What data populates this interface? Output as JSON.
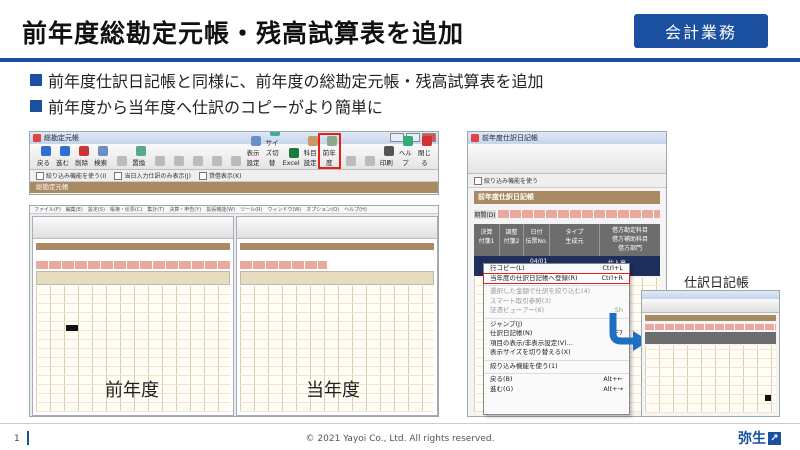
{
  "slide": {
    "title": "前年度総勘定元帳・残高試算表を追加",
    "badge": "会計業務",
    "bullets": [
      "前年度仕訳日記帳と同様に、前年度の総勘定元帳・残高試算表を追加",
      "前年度から当年度へ仕訳のコピーがより簡単に"
    ]
  },
  "ledger_window": {
    "title": "総勘定元帳",
    "toolbar": [
      "戻る",
      "進む",
      "削除",
      "検索",
      "",
      "置換",
      "",
      "",
      "",
      "",
      "",
      "表示設定",
      "サイズ切替",
      "Excel",
      "科目設定",
      "前年度",
      "",
      "",
      "印刷",
      "ヘルプ",
      "閉じる"
    ],
    "options": [
      "絞り込み機能を使う(I)",
      "当日入力仕訳のみ表示(J)",
      "貸借表示(K)"
    ],
    "section": "総勘定元帳",
    "highlighted_button": "前年度"
  },
  "compare": {
    "left_label": "前年度",
    "right_label": "当年度"
  },
  "prev_journal_window": {
    "title": "前年度仕訳日記帳",
    "section": "前年度仕訳日記帳",
    "period_label": "期間(D)",
    "columns": [
      "決算",
      "調整",
      "日付",
      "タイプ",
      "借方勘定科目"
    ],
    "subcolumns": [
      "付箋1",
      "付箋2",
      "伝票No.",
      "生成元",
      "借方補助科目",
      "借方部門"
    ],
    "cell_date": "04/01",
    "cell_no": "993",
    "cell_account": "仕入高"
  },
  "context_menu": {
    "items": [
      {
        "label": "行コピー(L)",
        "key": "Ctrl+L",
        "dim": false,
        "hl": false
      },
      {
        "label": "当年度の仕訳日記帳へ登録(R)",
        "key": "Ctrl+R",
        "dim": false,
        "hl": true
      },
      {
        "label": "選択した金額で仕訳を絞り込む(4)",
        "key": "",
        "dim": true,
        "hl": false
      },
      {
        "label": "スマート取引参照(3)",
        "key": "",
        "dim": true,
        "hl": false
      },
      {
        "label": "証憑ビューアー(6)",
        "key": "Sh",
        "dim": true,
        "hl": false
      },
      {
        "label": "ジャンプ(J)",
        "key": "",
        "dim": false,
        "hl": false
      },
      {
        "label": "仕訳日記帳(N)",
        "key": "F7",
        "dim": false,
        "hl": false
      },
      {
        "label": "項目の表示/非表示設定(V)...",
        "key": "",
        "dim": false,
        "hl": false
      },
      {
        "label": "表示サイズを切り替える(X)",
        "key": "",
        "dim": false,
        "hl": false
      },
      {
        "label": "絞り込み機能を使う(1)",
        "key": "",
        "dim": false,
        "hl": false
      },
      {
        "label": "戻る(B)",
        "key": "Alt+←",
        "dim": false,
        "hl": false
      },
      {
        "label": "進む(G)",
        "key": "Alt+→",
        "dim": false,
        "hl": false
      }
    ]
  },
  "siwake_label": "仕訳日記帳",
  "footer": {
    "page": "1",
    "copyright": "© 2021 Yayoi Co., Ltd.  All rights reserved.",
    "logo": "弥生"
  },
  "colors": {
    "accent": "#1b4fa0",
    "highlight": "#e0221b",
    "section_brown": "#a98a63"
  }
}
